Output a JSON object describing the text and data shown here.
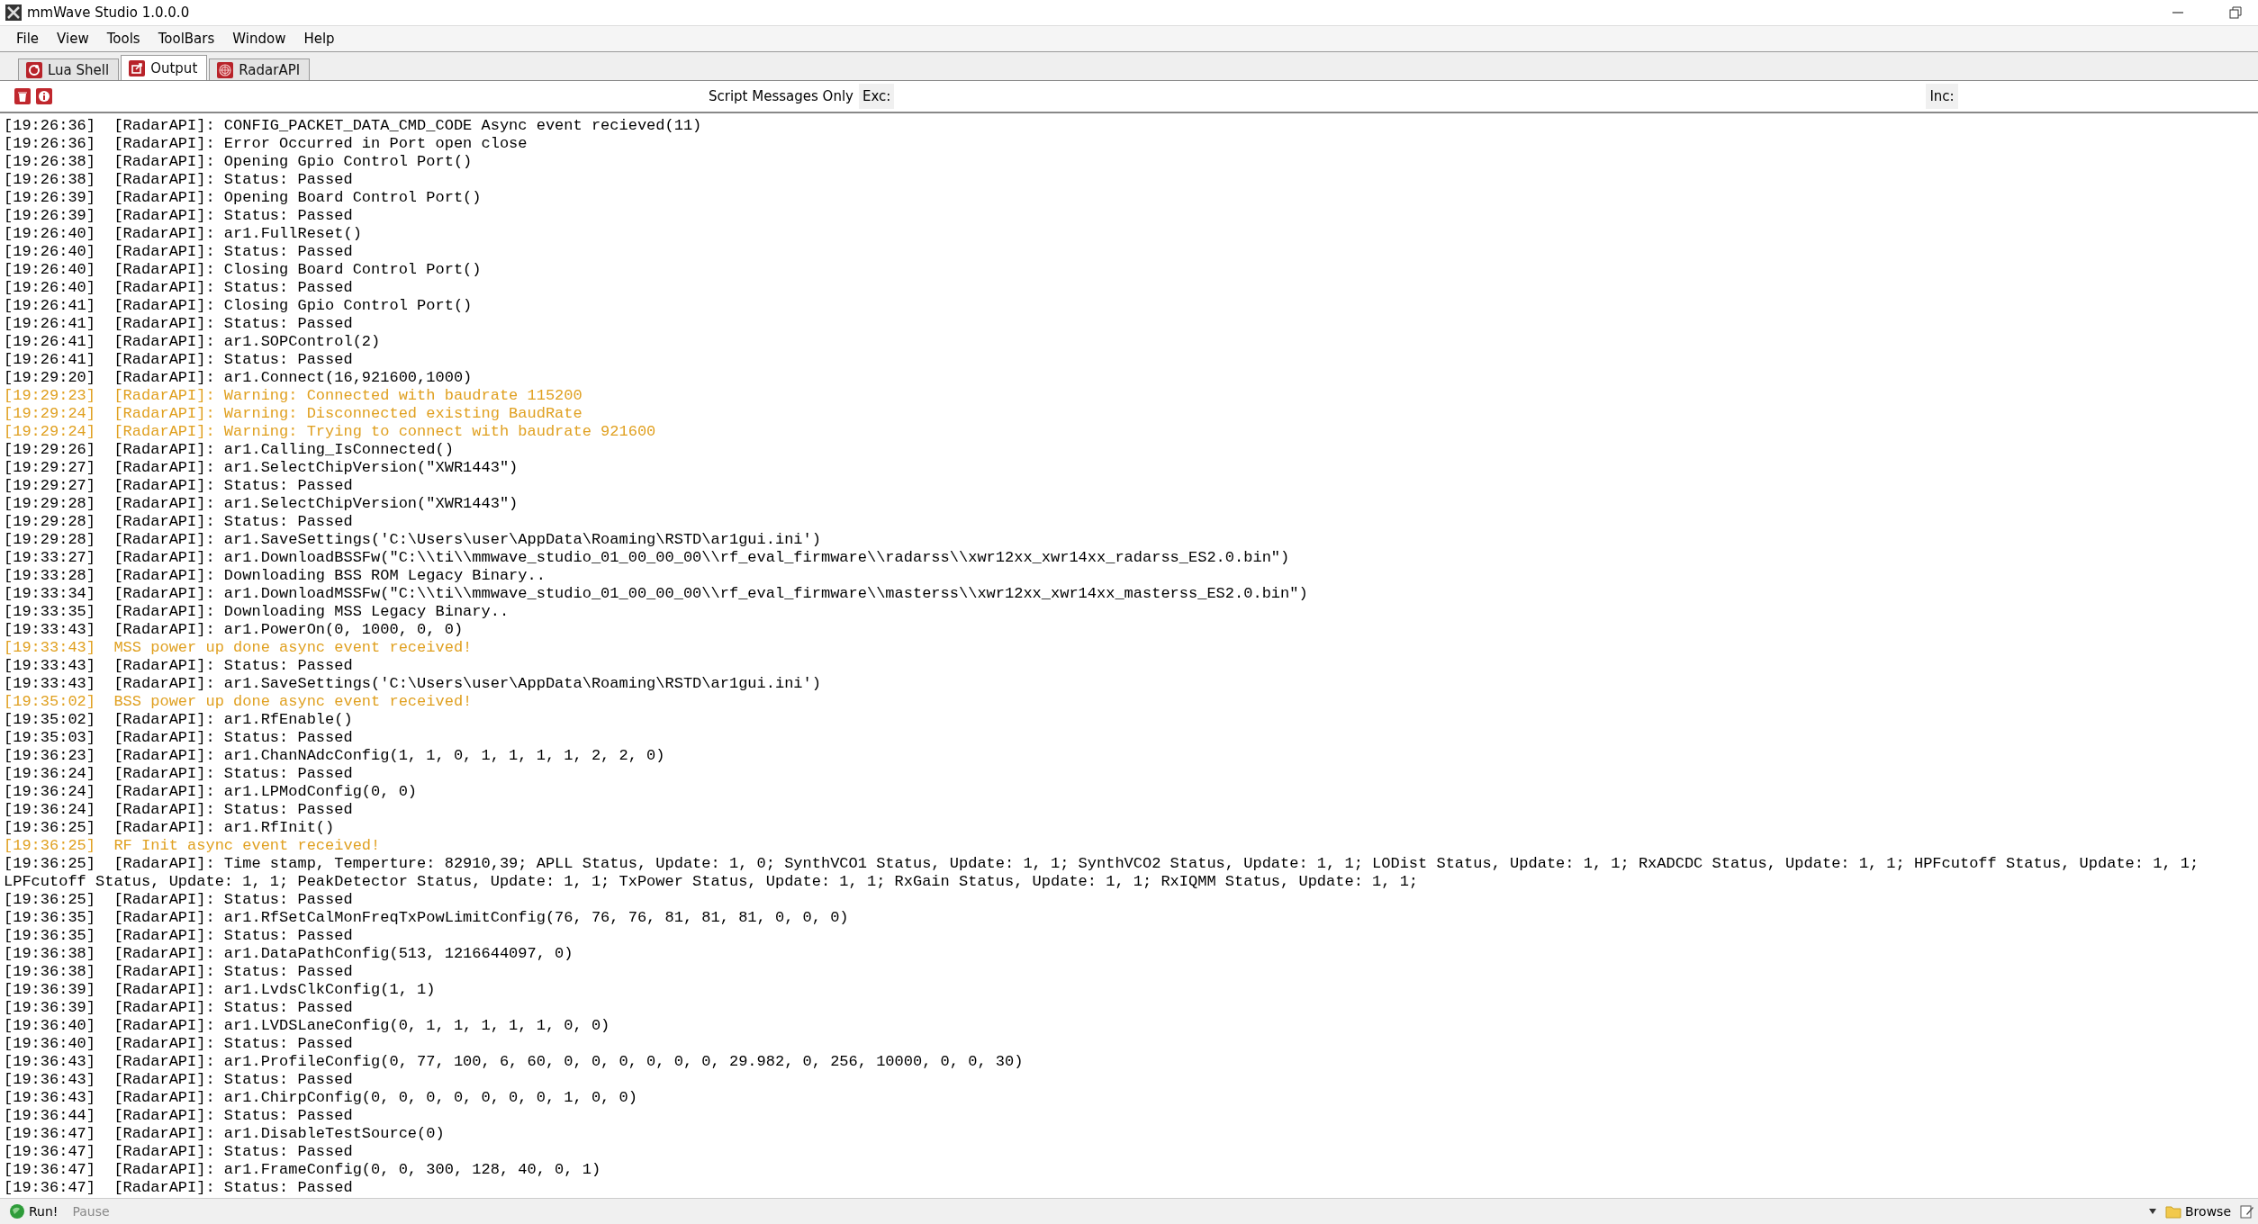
{
  "window": {
    "title": "mmWave Studio 1.0.0.0"
  },
  "menu": [
    "File",
    "View",
    "Tools",
    "ToolBars",
    "Window",
    "Help"
  ],
  "tabs": [
    {
      "label": "Lua Shell",
      "selected": false
    },
    {
      "label": "Output",
      "selected": true
    },
    {
      "label": "RadarAPI",
      "selected": false
    }
  ],
  "toolbar": {
    "filter_label": "Script Messages Only",
    "exclude_label": "Exc:",
    "include_label": "Inc:"
  },
  "log": [
    {
      "kind": "info",
      "text": "[19:26:36]  [RadarAPI]: CONFIG_PACKET_DATA_CMD_CODE Async event recieved(11)"
    },
    {
      "kind": "info",
      "text": "[19:26:36]  [RadarAPI]: Error Occurred in Port open close"
    },
    {
      "kind": "info",
      "text": "[19:26:38]  [RadarAPI]: Opening Gpio Control Port()"
    },
    {
      "kind": "info",
      "text": "[19:26:38]  [RadarAPI]: Status: Passed"
    },
    {
      "kind": "info",
      "text": "[19:26:39]  [RadarAPI]: Opening Board Control Port()"
    },
    {
      "kind": "info",
      "text": "[19:26:39]  [RadarAPI]: Status: Passed"
    },
    {
      "kind": "info",
      "text": "[19:26:40]  [RadarAPI]: ar1.FullReset()"
    },
    {
      "kind": "info",
      "text": "[19:26:40]  [RadarAPI]: Status: Passed"
    },
    {
      "kind": "info",
      "text": "[19:26:40]  [RadarAPI]: Closing Board Control Port()"
    },
    {
      "kind": "info",
      "text": "[19:26:40]  [RadarAPI]: Status: Passed"
    },
    {
      "kind": "info",
      "text": "[19:26:41]  [RadarAPI]: Closing Gpio Control Port()"
    },
    {
      "kind": "info",
      "text": "[19:26:41]  [RadarAPI]: Status: Passed"
    },
    {
      "kind": "info",
      "text": "[19:26:41]  [RadarAPI]: ar1.SOPControl(2)"
    },
    {
      "kind": "info",
      "text": "[19:26:41]  [RadarAPI]: Status: Passed"
    },
    {
      "kind": "info",
      "text": "[19:29:20]  [RadarAPI]: ar1.Connect(16,921600,1000)"
    },
    {
      "kind": "warning",
      "text": "[19:29:23]  [RadarAPI]: Warning: Connected with baudrate 115200"
    },
    {
      "kind": "warning",
      "text": "[19:29:24]  [RadarAPI]: Warning: Disconnected existing BaudRate"
    },
    {
      "kind": "warning",
      "text": "[19:29:24]  [RadarAPI]: Warning: Trying to connect with baudrate 921600"
    },
    {
      "kind": "info",
      "text": "[19:29:26]  [RadarAPI]: ar1.Calling_IsConnected()"
    },
    {
      "kind": "info",
      "text": "[19:29:27]  [RadarAPI]: ar1.SelectChipVersion(\"XWR1443\")"
    },
    {
      "kind": "info",
      "text": "[19:29:27]  [RadarAPI]: Status: Passed"
    },
    {
      "kind": "info",
      "text": "[19:29:28]  [RadarAPI]: ar1.SelectChipVersion(\"XWR1443\")"
    },
    {
      "kind": "info",
      "text": "[19:29:28]  [RadarAPI]: Status: Passed"
    },
    {
      "kind": "info",
      "text": "[19:29:28]  [RadarAPI]: ar1.SaveSettings('C:\\Users\\user\\AppData\\Roaming\\RSTD\\ar1gui.ini')"
    },
    {
      "kind": "info",
      "text": "[19:33:27]  [RadarAPI]: ar1.DownloadBSSFw(\"C:\\\\ti\\\\mmwave_studio_01_00_00_00\\\\rf_eval_firmware\\\\radarss\\\\xwr12xx_xwr14xx_radarss_ES2.0.bin\")"
    },
    {
      "kind": "info",
      "text": "[19:33:28]  [RadarAPI]: Downloading BSS ROM Legacy Binary.."
    },
    {
      "kind": "info",
      "text": "[19:33:34]  [RadarAPI]: ar1.DownloadMSSFw(\"C:\\\\ti\\\\mmwave_studio_01_00_00_00\\\\rf_eval_firmware\\\\masterss\\\\xwr12xx_xwr14xx_masterss_ES2.0.bin\")"
    },
    {
      "kind": "info",
      "text": "[19:33:35]  [RadarAPI]: Downloading MSS Legacy Binary.."
    },
    {
      "kind": "info",
      "text": "[19:33:43]  [RadarAPI]: ar1.PowerOn(0, 1000, 0, 0)"
    },
    {
      "kind": "warning",
      "text": "[19:33:43]  MSS power up done async event received!"
    },
    {
      "kind": "info",
      "text": "[19:33:43]  [RadarAPI]: Status: Passed"
    },
    {
      "kind": "info",
      "text": "[19:33:43]  [RadarAPI]: ar1.SaveSettings('C:\\Users\\user\\AppData\\Roaming\\RSTD\\ar1gui.ini')"
    },
    {
      "kind": "warning",
      "text": "[19:35:02]  BSS power up done async event received!"
    },
    {
      "kind": "info",
      "text": "[19:35:02]  [RadarAPI]: ar1.RfEnable()"
    },
    {
      "kind": "info",
      "text": "[19:35:03]  [RadarAPI]: Status: Passed"
    },
    {
      "kind": "info",
      "text": "[19:36:23]  [RadarAPI]: ar1.ChanNAdcConfig(1, 1, 0, 1, 1, 1, 1, 2, 2, 0)"
    },
    {
      "kind": "info",
      "text": "[19:36:24]  [RadarAPI]: Status: Passed"
    },
    {
      "kind": "info",
      "text": "[19:36:24]  [RadarAPI]: ar1.LPModConfig(0, 0)"
    },
    {
      "kind": "info",
      "text": "[19:36:24]  [RadarAPI]: Status: Passed"
    },
    {
      "kind": "info",
      "text": "[19:36:25]  [RadarAPI]: ar1.RfInit()"
    },
    {
      "kind": "warning",
      "text": "[19:36:25]  RF Init async event received!"
    },
    {
      "kind": "info",
      "text": "[19:36:25]  [RadarAPI]: Time stamp, Temperture: 82910,39; APLL Status, Update: 1, 0; SynthVCO1 Status, Update: 1, 1; SynthVCO2 Status, Update: 1, 1; LODist Status, Update: 1, 1; RxADCDC Status, Update: 1, 1; HPFcutoff Status, Update: 1, 1; LPFcutoff Status, Update: 1, 1; PeakDetector Status, Update: 1, 1; TxPower Status, Update: 1, 1; RxGain Status, Update: 1, 1; RxIQMM Status, Update: 1, 1;"
    },
    {
      "kind": "info",
      "text": "[19:36:25]  [RadarAPI]: Status: Passed"
    },
    {
      "kind": "info",
      "text": "[19:36:35]  [RadarAPI]: ar1.RfSetCalMonFreqTxPowLimitConfig(76, 76, 76, 81, 81, 81, 0, 0, 0)"
    },
    {
      "kind": "info",
      "text": "[19:36:35]  [RadarAPI]: Status: Passed"
    },
    {
      "kind": "info",
      "text": "[19:36:38]  [RadarAPI]: ar1.DataPathConfig(513, 1216644097, 0)"
    },
    {
      "kind": "info",
      "text": "[19:36:38]  [RadarAPI]: Status: Passed"
    },
    {
      "kind": "info",
      "text": "[19:36:39]  [RadarAPI]: ar1.LvdsClkConfig(1, 1)"
    },
    {
      "kind": "info",
      "text": "[19:36:39]  [RadarAPI]: Status: Passed"
    },
    {
      "kind": "info",
      "text": "[19:36:40]  [RadarAPI]: ar1.LVDSLaneConfig(0, 1, 1, 1, 1, 1, 0, 0)"
    },
    {
      "kind": "info",
      "text": "[19:36:40]  [RadarAPI]: Status: Passed"
    },
    {
      "kind": "info",
      "text": "[19:36:43]  [RadarAPI]: ar1.ProfileConfig(0, 77, 100, 6, 60, 0, 0, 0, 0, 0, 0, 29.982, 0, 256, 10000, 0, 0, 30)"
    },
    {
      "kind": "info",
      "text": "[19:36:43]  [RadarAPI]: Status: Passed"
    },
    {
      "kind": "info",
      "text": "[19:36:43]  [RadarAPI]: ar1.ChirpConfig(0, 0, 0, 0, 0, 0, 0, 1, 0, 0)"
    },
    {
      "kind": "info",
      "text": "[19:36:44]  [RadarAPI]: Status: Passed"
    },
    {
      "kind": "info",
      "text": "[19:36:47]  [RadarAPI]: ar1.DisableTestSource(0)"
    },
    {
      "kind": "info",
      "text": "[19:36:47]  [RadarAPI]: Status: Passed"
    },
    {
      "kind": "info",
      "text": "[19:36:47]  [RadarAPI]: ar1.FrameConfig(0, 0, 300, 128, 40, 0, 1)"
    },
    {
      "kind": "info",
      "text": "[19:36:47]  [RadarAPI]: Status: Passed"
    }
  ],
  "status_bar": {
    "run_label": "Run!",
    "pause": {
      "label": "Pause",
      "disabled": true
    },
    "browse_label": "Browse"
  }
}
